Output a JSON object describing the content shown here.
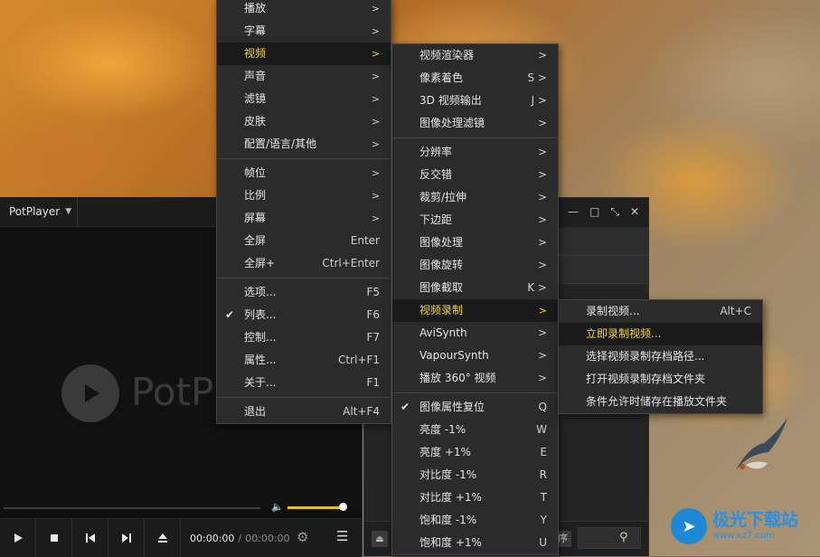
{
  "player": {
    "app_menu_label": "PotPlayer",
    "logo_text": "PotP",
    "time_current": "00:00:00",
    "time_separator": "/",
    "time_total": "00:00:00",
    "volume_level": 0.92
  },
  "playlist": {
    "sort_fragment": "序"
  },
  "main_menu": {
    "items": [
      {
        "label": "播放",
        "submenu": true
      },
      {
        "label": "字幕",
        "submenu": true
      },
      {
        "label": "视频",
        "submenu": true,
        "highlighted": true
      },
      {
        "label": "声音",
        "submenu": true
      },
      {
        "label": "滤镜",
        "submenu": true
      },
      {
        "label": "皮肤",
        "submenu": true
      },
      {
        "label": "配置/语言/其他",
        "submenu": true
      },
      {
        "label": "帧位",
        "submenu": true
      },
      {
        "label": "比例",
        "submenu": true
      },
      {
        "label": "屏幕",
        "submenu": true
      },
      {
        "label": "全屏",
        "shortcut": "Enter"
      },
      {
        "label": "全屏+",
        "shortcut": "Ctrl+Enter"
      },
      {
        "label": "选项...",
        "shortcut": "F5"
      },
      {
        "label": "列表...",
        "shortcut": "F6",
        "checked": true
      },
      {
        "label": "控制...",
        "shortcut": "F7"
      },
      {
        "label": "属性...",
        "shortcut": "Ctrl+F1"
      },
      {
        "label": "关于...",
        "shortcut": "F1"
      },
      {
        "label": "退出",
        "shortcut": "Alt+F4"
      }
    ],
    "arrow": ">"
  },
  "video_menu": {
    "items": [
      {
        "label": "视频渲染器",
        "right": ">"
      },
      {
        "label": "像素着色",
        "right": "S >"
      },
      {
        "label": "3D 视频输出",
        "right": "J >"
      },
      {
        "label": "图像处理滤镜",
        "right": ">"
      },
      {
        "label": "分辨率",
        "right": ">"
      },
      {
        "label": "反交错",
        "right": ">"
      },
      {
        "label": "裁剪/拉伸",
        "right": ">"
      },
      {
        "label": "下边距",
        "right": ">"
      },
      {
        "label": "图像处理",
        "right": ">"
      },
      {
        "label": "图像旋转",
        "right": ">"
      },
      {
        "label": "图像截取",
        "right": "K >"
      },
      {
        "label": "视频录制",
        "right": ">",
        "highlighted": true
      },
      {
        "label": "AviSynth",
        "right": ">"
      },
      {
        "label": "VapourSynth",
        "right": ">"
      },
      {
        "label": "播放 360° 视频",
        "right": ">"
      },
      {
        "label": "图像属性复位",
        "right": "Q",
        "checked": true
      },
      {
        "label": "亮度 -1%",
        "right": "W"
      },
      {
        "label": "亮度 +1%",
        "right": "E"
      },
      {
        "label": "对比度 -1%",
        "right": "R"
      },
      {
        "label": "对比度 +1%",
        "right": "T"
      },
      {
        "label": "饱和度 -1%",
        "right": "Y"
      },
      {
        "label": "饱和度 +1%",
        "right": "U"
      }
    ]
  },
  "record_menu": {
    "items": [
      {
        "label": "录制视频...",
        "shortcut": "Alt+C"
      },
      {
        "label": "立即录制视频...",
        "highlighted": true
      },
      {
        "label": "选择视频录制存档路径..."
      },
      {
        "label": "打开视频录制存档文件夹"
      },
      {
        "label": "条件允许时储存在播放文件夹"
      }
    ]
  },
  "watermark": {
    "name": "极光下载站",
    "url": "www.xz7.com"
  }
}
